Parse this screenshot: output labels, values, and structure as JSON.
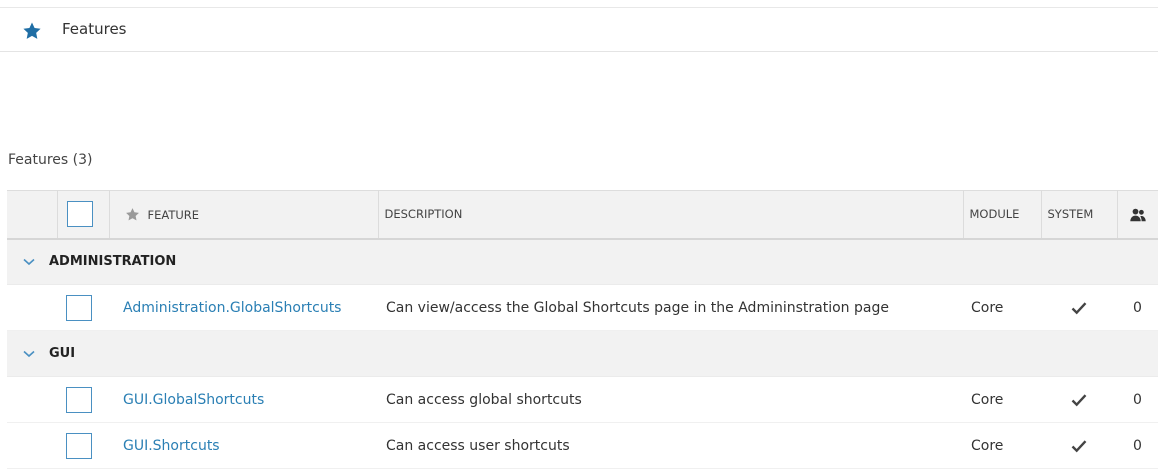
{
  "header": {
    "title": "Features"
  },
  "section": {
    "title": "Features (3)"
  },
  "columns": {
    "feature": "FEATURE",
    "description": "DESCRIPTION",
    "module": "MODULE",
    "system": "SYSTEM"
  },
  "icons": {
    "header": "star-icon",
    "feature_column": "star-icon",
    "users_column": "users-icon",
    "group_toggle": "chevron-down-icon",
    "system_flag": "checkmark-icon"
  },
  "colors": {
    "accent": "#2a7fb4",
    "star": "#1f6ea5",
    "header_bg": "#f2f2f2"
  },
  "groups": [
    {
      "label": "ADMINISTRATION",
      "rows": [
        {
          "feature": "Administration.GlobalShortcuts",
          "description": "Can view/access the Global Shortcuts page in the Admininstration page",
          "module": "Core",
          "system": true,
          "users": "0"
        }
      ]
    },
    {
      "label": "GUI",
      "rows": [
        {
          "feature": "GUI.GlobalShortcuts",
          "description": "Can access global shortcuts",
          "module": "Core",
          "system": true,
          "users": "0"
        },
        {
          "feature": "GUI.Shortcuts",
          "description": "Can access user shortcuts",
          "module": "Core",
          "system": true,
          "users": "0"
        }
      ]
    }
  ]
}
